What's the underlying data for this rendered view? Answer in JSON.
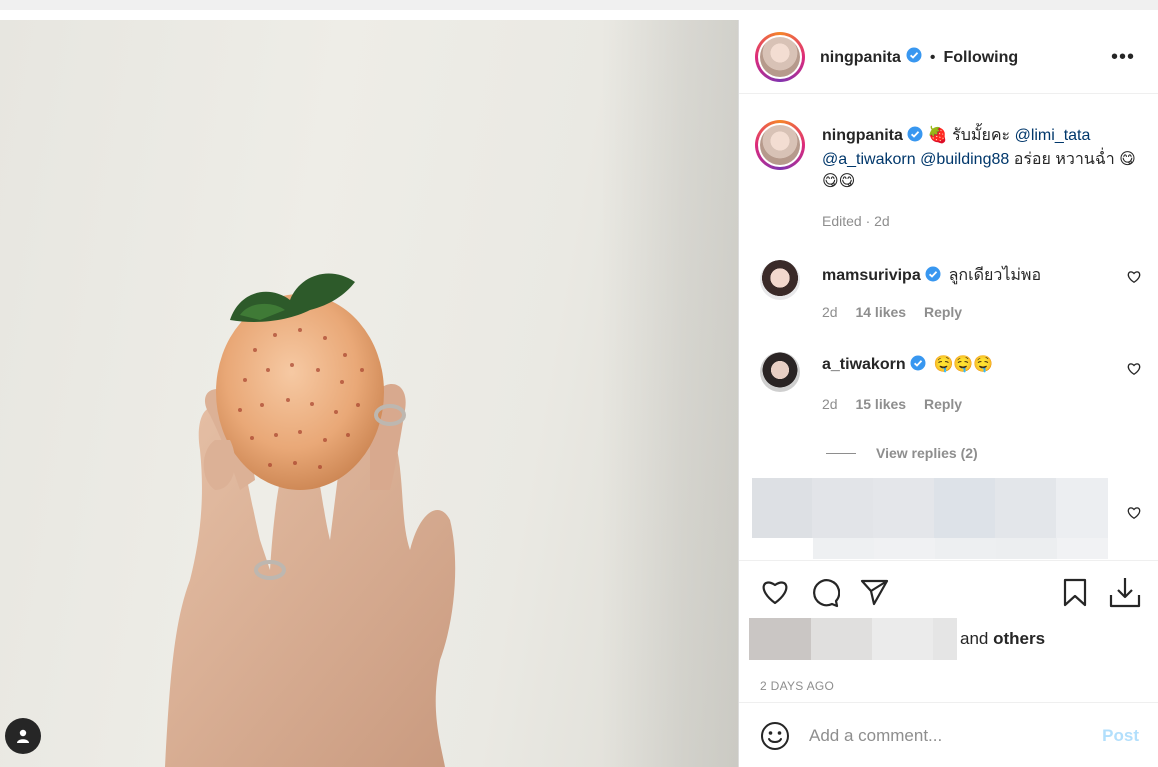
{
  "post": {
    "author": "ningpanita",
    "follow_status": "Following",
    "caption_emoji": "🍓",
    "caption_text_1": " รับมั้ยคะ ",
    "mention_1": "@limi_tata",
    "mention_2": "@a_tiwakorn",
    "mention_3": "@building88",
    "caption_text_2": " อร่อย หวานฉ่ำ",
    "caption_emojis_end": "😋😋😋",
    "caption_meta": "Edited · 2d"
  },
  "comments": [
    {
      "user": "mamsurivipa",
      "text": "ลูกเดียวไม่พอ",
      "time": "2d",
      "likes": "14 likes",
      "reply": "Reply"
    },
    {
      "user": "a_tiwakorn",
      "text": "🤤🤤🤤",
      "time": "2d",
      "likes": "15 likes",
      "reply": "Reply",
      "view_replies": "View replies (2)"
    }
  ],
  "likes": {
    "suffix_and": "and ",
    "suffix_others": "others"
  },
  "timeago": "2 DAYS AGO",
  "add_comment": {
    "placeholder": "Add a comment...",
    "post_label": "Post"
  },
  "colors": {
    "verified": "#3897f0",
    "link": "#00376b",
    "post_disabled": "#b2dffc"
  },
  "icons": [
    "heart-icon",
    "comment-icon",
    "share-icon",
    "bookmark-icon",
    "download-icon",
    "emoji-icon",
    "more-icon",
    "user-tag-icon",
    "verified-icon"
  ]
}
